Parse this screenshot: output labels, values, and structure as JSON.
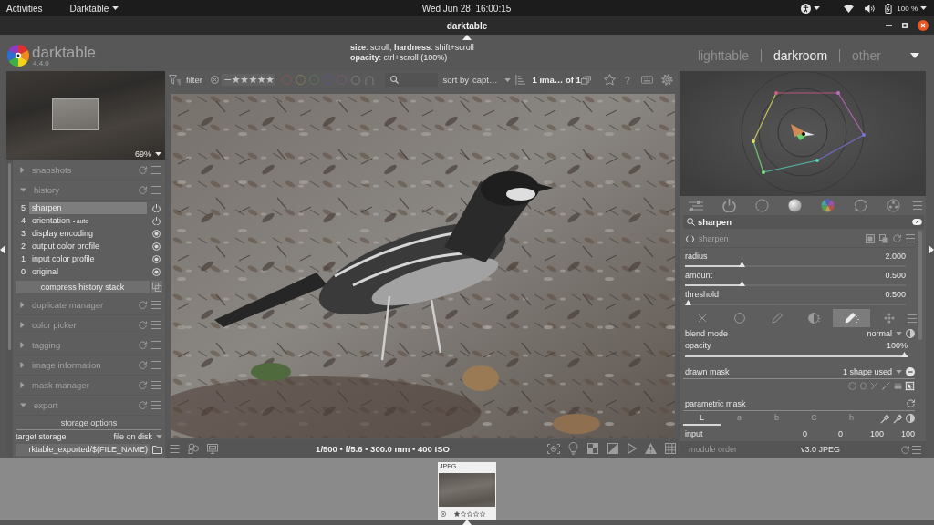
{
  "top_bar": {
    "activities": "Activities",
    "app_menu": "Darktable",
    "clock": "Wed Jun 28  16:00:15",
    "battery": "100 %"
  },
  "window": {
    "title": "darktable"
  },
  "header": {
    "app_name": "darktable",
    "version": "4.4.0",
    "hints": [
      "**size**: scroll, **hardness**: shift+scroll",
      "**opacity**: ctrl+scroll (100%)"
    ],
    "views": [
      {
        "label": "lighttable",
        "selected": false
      },
      {
        "label": "darkroom",
        "selected": true
      },
      {
        "label": "other",
        "selected": false
      }
    ]
  },
  "left_panel": {
    "navigation": {
      "zoom": "69%"
    },
    "modules": [
      {
        "label": "snapshots",
        "kind": "plain",
        "expanded": false
      },
      {
        "label": "history",
        "kind": "history",
        "expanded": true,
        "items": [
          {
            "number": "5",
            "label": "sharpen",
            "kind": "switchable",
            "selected": true
          },
          {
            "number": "4",
            "label": "orientation",
            "note": "• auto",
            "kind": "switchable",
            "selected": false
          },
          {
            "number": "3",
            "label": "display encoding",
            "kind": "fixed",
            "selected": false
          },
          {
            "number": "2",
            "label": "output color profile",
            "kind": "fixed",
            "selected": false
          },
          {
            "number": "1",
            "label": "input color profile",
            "kind": "fixed",
            "selected": false
          },
          {
            "number": "0",
            "label": "original",
            "kind": "fixed",
            "selected": false
          }
        ],
        "button": "compress history stack"
      },
      {
        "label": "duplicate manager",
        "kind": "plain",
        "expanded": false
      },
      {
        "label": "color picker",
        "kind": "plain",
        "expanded": false
      },
      {
        "label": "tagging",
        "kind": "plain",
        "expanded": false
      },
      {
        "label": "image information",
        "kind": "plain",
        "expanded": false
      },
      {
        "label": "mask manager",
        "kind": "plain",
        "expanded": false
      },
      {
        "label": "export",
        "kind": "export",
        "expanded": true,
        "section": "storage options",
        "target_label": "target storage",
        "target_value": "file on disk",
        "path": "rktable_exported/$(FILE_NAME)"
      }
    ]
  },
  "center": {
    "filter_bar": {
      "label": "filter",
      "rating_range": "−★★★★★",
      "color_labels": [
        {
          "color": "#8a5656"
        },
        {
          "color": "#8a7a50"
        },
        {
          "color": "#587a58"
        },
        {
          "color": "#58588a"
        },
        {
          "color": "#7a587a"
        }
      ],
      "sort_label": "sort by",
      "sort_value": "capt…",
      "count": "1 ima… of 1",
      "help": "?"
    },
    "exif": "1/500 • f/5.6 • 300.0 mm • 400 ISO"
  },
  "right_panel": {
    "module_search": {
      "value": "sharpen"
    },
    "module": {
      "name": "sharpen",
      "enabled": true,
      "sliders": [
        {
          "label": "radius",
          "value": "2.000",
          "level": 0.25
        },
        {
          "label": "amount",
          "value": "0.500",
          "level": 0.25
        },
        {
          "label": "threshold",
          "value": "0.500",
          "level": 0
        }
      ],
      "blend_tabs": [
        {
          "kind": "off",
          "selected": false
        },
        {
          "kind": "uniform",
          "selected": false
        },
        {
          "kind": "drawn",
          "selected": false
        },
        {
          "kind": "parametric",
          "selected": false
        },
        {
          "kind": "drawn_parametric",
          "selected": true
        },
        {
          "kind": "raster",
          "selected": false
        }
      ],
      "blend_mode": {
        "label": "blend mode",
        "value": "normal"
      },
      "opacity": {
        "label": "opacity",
        "value": "100%",
        "level": 1
      },
      "drawn_mask": {
        "label": "drawn mask",
        "value": "1 shape used",
        "tools": [
          {
            "kind": "circle",
            "selected": false
          },
          {
            "kind": "ellipse",
            "selected": false
          },
          {
            "kind": "path",
            "selected": false
          },
          {
            "kind": "brush",
            "selected": false
          },
          {
            "kind": "gradient",
            "selected": false
          },
          {
            "kind": "edit",
            "selected": true
          }
        ]
      },
      "parametric_mask": {
        "label": "parametric mask",
        "channels": [
          {
            "label": "L",
            "selected": true
          },
          {
            "label": "a",
            "selected": false
          },
          {
            "label": "b",
            "selected": false
          },
          {
            "label": "C",
            "selected": false
          },
          {
            "label": "h",
            "selected": false
          }
        ],
        "input_label": "input",
        "input_values": [
          "0",
          "0",
          "100",
          "100"
        ]
      }
    },
    "module_order": {
      "label": "module order",
      "value": "v3.0 JPEG"
    }
  },
  "filmstrip": {
    "thumbnails": [
      {
        "format": "JPEG",
        "stars": 1
      }
    ]
  }
}
